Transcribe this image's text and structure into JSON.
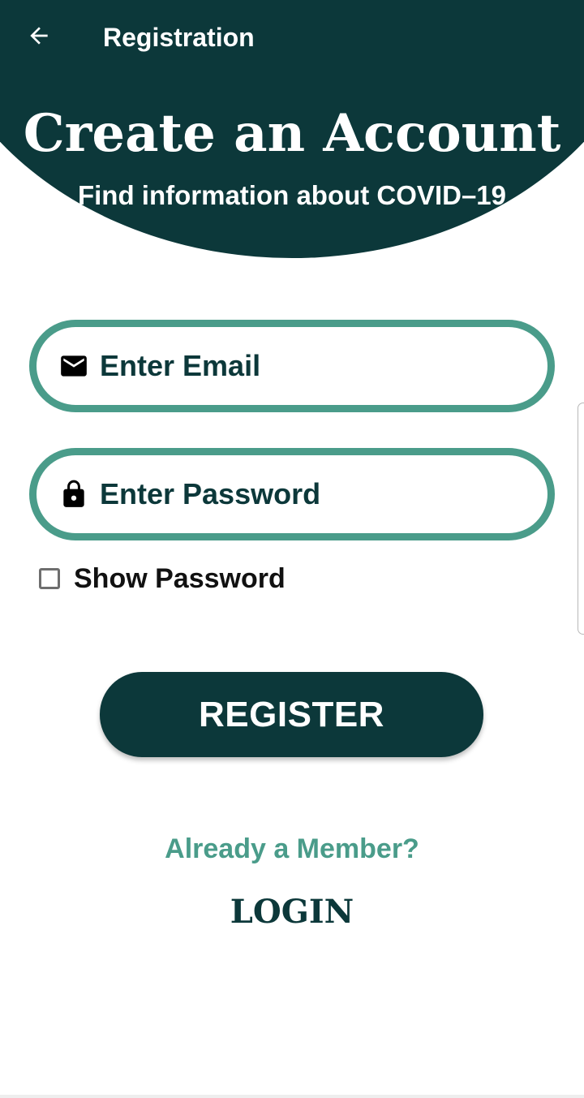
{
  "toolbar": {
    "title": "Registration",
    "back_icon": "arrow-left-icon"
  },
  "header": {
    "title": "Create an Account",
    "subtitle": "Find information about COVID–19"
  },
  "form": {
    "email": {
      "placeholder": "Enter Email",
      "value": "",
      "icon": "mail-icon"
    },
    "password": {
      "placeholder": "Enter Password",
      "value": "",
      "icon": "lock-icon"
    },
    "show_password": {
      "label": "Show Password",
      "checked": false
    },
    "register_label": "REGISTER"
  },
  "footer": {
    "prompt": "Already a Member?",
    "login_label": "LOGIN"
  },
  "colors": {
    "primary": "#0c383a",
    "accent": "#4a9c8a",
    "background": "#ffffff"
  }
}
